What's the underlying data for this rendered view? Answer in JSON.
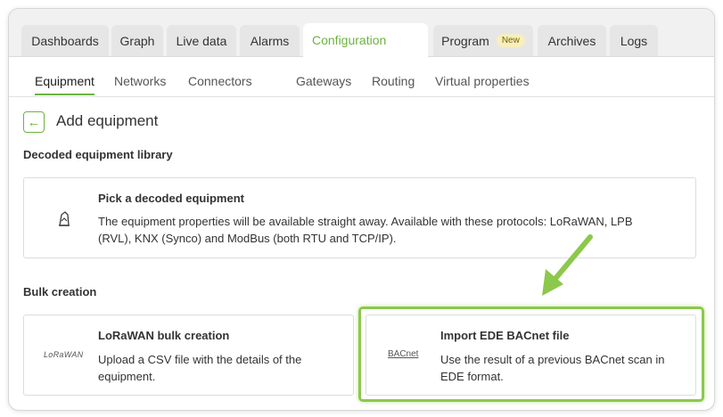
{
  "tabs": [
    {
      "label": "Dashboards"
    },
    {
      "label": "Graph"
    },
    {
      "label": "Live data"
    },
    {
      "label": "Alarms"
    },
    {
      "label": "Configuration"
    },
    {
      "label": "Program",
      "badge": "New"
    },
    {
      "label": "Archives"
    },
    {
      "label": "Logs"
    }
  ],
  "subnav": [
    "Equipment",
    "Networks",
    "Connectors",
    "Gateways",
    "Routing",
    "Virtual properties"
  ],
  "page": {
    "title": "Add equipment"
  },
  "sections": {
    "library": "Decoded equipment library",
    "bulk": "Bulk creation"
  },
  "cards": {
    "decoded": {
      "title": "Pick a decoded equipment",
      "desc": "The equipment properties will be available straight away. Available with these protocols: LoRaWAN, LPB (RVL), KNX (Synco) and ModBus (both RTU and TCP/IP).",
      "icon": "library-icon"
    },
    "lorawan": {
      "title": "LoRaWAN bulk creation",
      "desc": "Upload a CSV file with the details of the equipment.",
      "logo": "LoRaWAN"
    },
    "bacnet": {
      "title": "Import EDE BACnet file",
      "desc": "Use the result of a previous BACnet scan in EDE format.",
      "logo": "BACnet"
    }
  },
  "colors": {
    "accent": "#6cb33f",
    "annotation": "#8cc84b"
  }
}
